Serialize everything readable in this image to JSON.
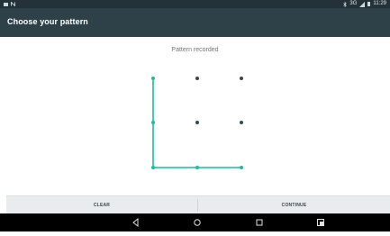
{
  "status_bar": {
    "time": "11:29",
    "signal_label": "3G"
  },
  "app_bar": {
    "title": "Choose your pattern"
  },
  "header": {
    "message": "Pattern recorded"
  },
  "pattern": {
    "grid_size": 3,
    "selected_sequence": [
      1,
      4,
      7,
      8,
      9
    ],
    "line_color": "#1abc9c",
    "dot_color": "#37474f"
  },
  "buttons": {
    "clear_label": "CLEAR",
    "continue_label": "CONTINUE"
  },
  "nav_bar": {
    "icons": [
      "back-icon",
      "home-icon",
      "recents-icon",
      "screenshot-icon"
    ]
  }
}
